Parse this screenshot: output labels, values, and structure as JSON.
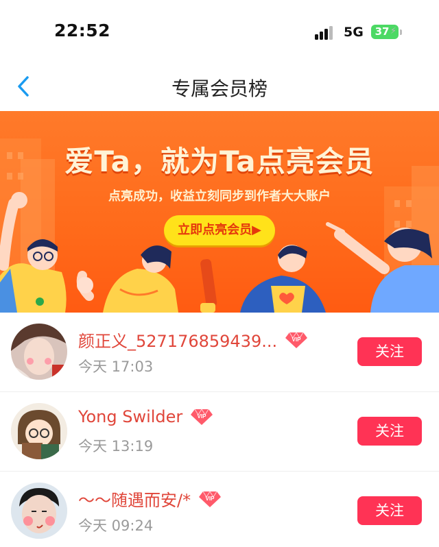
{
  "status": {
    "time": "22:52",
    "network": "5G",
    "battery": "37"
  },
  "nav": {
    "title": "专属会员榜"
  },
  "banner": {
    "headline": "爱Ta，就为Ta点亮会员",
    "subtitle": "点亮成功，收益立刻同步到作者大大账户",
    "button_label": "立即点亮会员▶"
  },
  "members": [
    {
      "name": "颜正义_527176859439...",
      "time": "今天 17:03",
      "follow_label": "关注"
    },
    {
      "name": "Yong Swilder",
      "time": "今天 13:19",
      "follow_label": "关注"
    },
    {
      "name": "～～随遇而安/*",
      "time": "今天 09:24",
      "follow_label": "关注"
    }
  ],
  "colors": {
    "accent": "#ff3355",
    "name_red": "#e0463a",
    "banner_orange": "#ff6a1a",
    "button_yellow": "#ffe21a"
  },
  "icons": [
    "back-chevron-icon",
    "signal-icon",
    "battery-icon",
    "vip-diamond-icon"
  ]
}
